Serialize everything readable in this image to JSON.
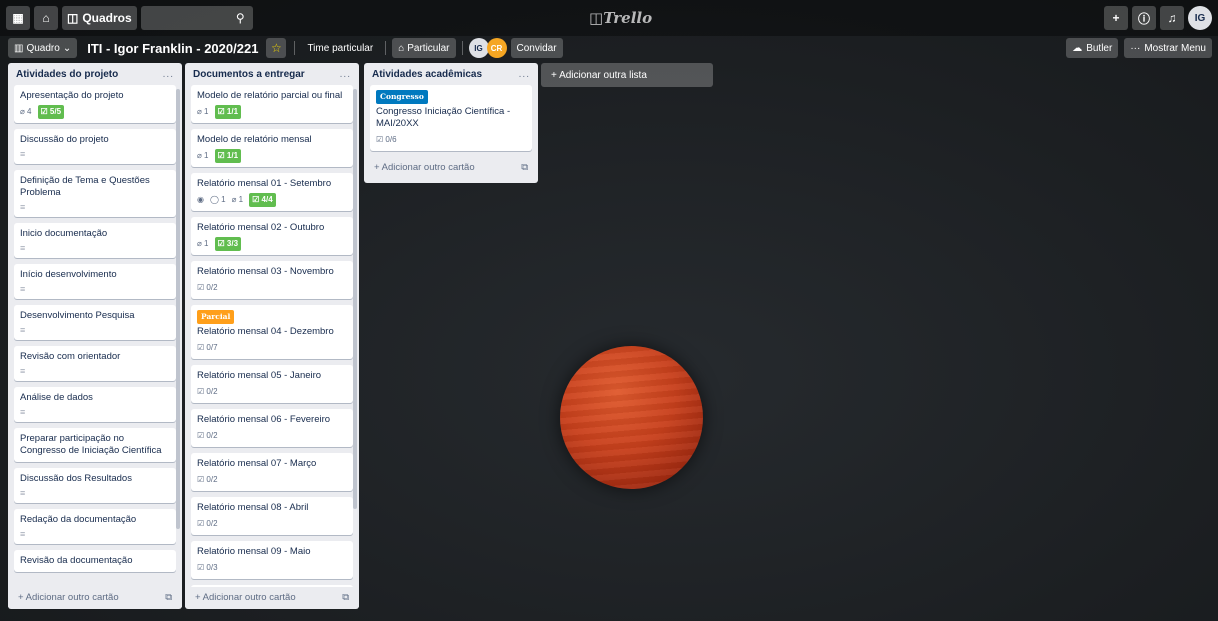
{
  "header": {
    "apps_icon": "grid-icon",
    "home_icon": "home-icon",
    "boards_label": "Quadros",
    "search_icon": "search-icon",
    "logo": "Trello",
    "plus_icon": "plus-icon",
    "info_icon": "info-icon",
    "bell_icon": "bell-icon",
    "user_initials": "IG"
  },
  "board": {
    "view_label": "Quadro",
    "title": "ITI - Igor Franklin - 2020/221",
    "team_label": "Time particular",
    "visibility_label": "Particular",
    "members": [
      {
        "initials": "IG",
        "color": "#dfe1e6",
        "text": "#172b4d"
      },
      {
        "initials": "CR",
        "color": "#f5a623",
        "text": "#ffffff"
      }
    ],
    "invite_label": "Convidar",
    "butler_label": "Butler",
    "menu_label": "Mostrar Menu"
  },
  "lists": [
    {
      "title": "Atividades do projeto",
      "more": "...",
      "add_label": "+ Adicionar outro cartão",
      "cards": [
        {
          "title": "Apresentação do projeto",
          "attachments": "4",
          "checklist": "5/5"
        },
        {
          "title": "Discussão do projeto",
          "desc": true
        },
        {
          "title": "Definição de Tema e Questões Problema",
          "desc": true
        },
        {
          "title": "Inicio documentação",
          "desc": true
        },
        {
          "title": "Início desenvolvimento",
          "desc": true
        },
        {
          "title": "Desenvolvimento Pesquisa",
          "desc": true
        },
        {
          "title": "Revisão com orientador",
          "desc": true
        },
        {
          "title": "Análise de dados",
          "desc": true
        },
        {
          "title": "Preparar participação no Congresso de Iniciação Científica"
        },
        {
          "title": "Discussão dos Resultados",
          "desc": true
        },
        {
          "title": "Redação da documentação",
          "desc": true
        },
        {
          "title": "Revisão da documentação"
        }
      ]
    },
    {
      "title": "Documentos a entregar",
      "more": "...",
      "add_label": "+ Adicionar outro cartão",
      "cards": [
        {
          "title": "Modelo de relatório parcial ou final",
          "attachments": "1",
          "checklist": "1/1"
        },
        {
          "title": "Modelo de relatório mensal",
          "attachments": "1",
          "checklist": "1/1"
        },
        {
          "title": "Relatório mensal 01 - Setembro",
          "watch": true,
          "comments": "1",
          "attachments": "1",
          "checklist": "4/4"
        },
        {
          "title": "Relatório mensal 02 - Outubro",
          "attachments": "1",
          "checklist": "3/3"
        },
        {
          "title": "Relatório mensal 03 - Novembro",
          "checklist_open": "0/2"
        },
        {
          "title": "Relatório mensal 04 - Dezembro",
          "label": "Parcial",
          "label_color": "#ff9f1a",
          "checklist_open": "0/7"
        },
        {
          "title": "Relatório mensal 05 - Janeiro",
          "checklist_open": "0/2"
        },
        {
          "title": "Relatório mensal 06 - Fevereiro",
          "checklist_open": "0/2"
        },
        {
          "title": "Relatório mensal 07 - Março",
          "checklist_open": "0/2"
        },
        {
          "title": "Relatório mensal 08 - Abril",
          "checklist_open": "0/2"
        },
        {
          "title": "Relatório mensal 09 - Maio",
          "checklist_open": "0/3"
        },
        {
          "title": "Relatório mensal 10 - Junho"
        }
      ]
    },
    {
      "title": "Atividades acadêmicas",
      "more": "...",
      "add_label": "+ Adicionar outro cartão",
      "cards": [
        {
          "title": "Congresso Iniciação Científica - MAI/20XX",
          "label": "Congresso",
          "label_color": "#0079bf",
          "checklist_open": "0/6"
        }
      ]
    }
  ],
  "add_list_label": "+ Adicionar outra lista"
}
